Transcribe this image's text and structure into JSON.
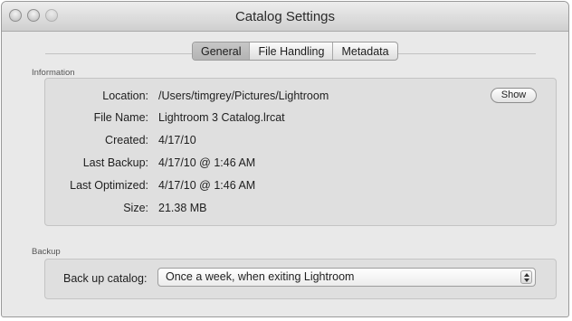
{
  "window": {
    "title": "Catalog Settings"
  },
  "tabs": [
    {
      "label": "General",
      "active": true
    },
    {
      "label": "File Handling",
      "active": false
    },
    {
      "label": "Metadata",
      "active": false
    }
  ],
  "information": {
    "section_label": "Information",
    "rows": [
      {
        "label": "Location:",
        "value": "/Users/timgrey/Pictures/Lightroom"
      },
      {
        "label": "File Name:",
        "value": "Lightroom 3 Catalog.lrcat"
      },
      {
        "label": "Created:",
        "value": "4/17/10"
      },
      {
        "label": "Last Backup:",
        "value": "4/17/10 @ 1:46 AM"
      },
      {
        "label": "Last Optimized:",
        "value": "4/17/10 @ 1:46 AM"
      },
      {
        "label": "Size:",
        "value": "21.38 MB"
      }
    ],
    "show_button": "Show"
  },
  "backup": {
    "section_label": "Backup",
    "label": "Back up catalog:",
    "selected": "Once a week, when exiting Lightroom"
  }
}
